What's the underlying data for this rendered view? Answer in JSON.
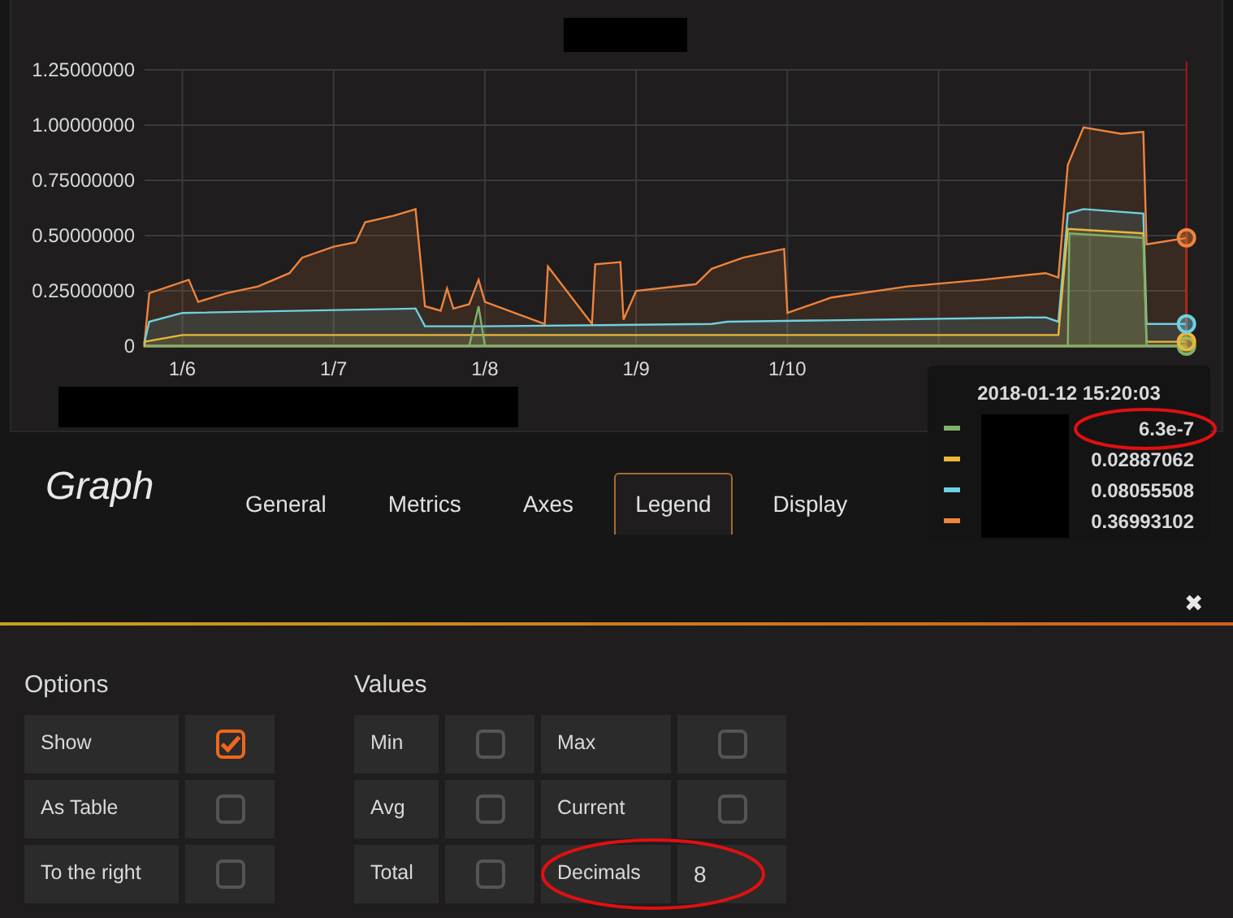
{
  "panel": {
    "chart_data": {
      "type": "area",
      "xlim": [
        "2018-01-05T18:00",
        "2018-01-12T15:30"
      ],
      "ylim": [
        0,
        1.25
      ],
      "xticks": [
        {
          "value": "2018-01-06",
          "label": "1/6"
        },
        {
          "value": "2018-01-07",
          "label": "1/7"
        },
        {
          "value": "2018-01-08",
          "label": "1/8"
        },
        {
          "value": "2018-01-09",
          "label": "1/9"
        },
        {
          "value": "2018-01-10",
          "label": "1/10"
        }
      ],
      "yticks": [
        {
          "value": 0,
          "label": "0"
        },
        {
          "value": 0.25,
          "label": "0.25000000"
        },
        {
          "value": 0.5,
          "label": "0.50000000"
        },
        {
          "value": 0.75,
          "label": "0.75000000"
        },
        {
          "value": 1,
          "label": "1.00000000"
        },
        {
          "value": 1.25,
          "label": "1.25000000"
        }
      ],
      "series": [
        {
          "color": "#ef843c",
          "x": [
            "2018-01-05T18:00",
            "2018-01-05T18:45",
            "2018-01-06T01:00",
            "2018-01-06T02:30",
            "2018-01-06T07:00",
            "2018-01-06T12:00",
            "2018-01-06T17:00",
            "2018-01-06T19:00",
            "2018-01-07T00:00",
            "2018-01-07T03:30",
            "2018-01-07T05:00",
            "2018-01-07T09:30",
            "2018-01-07T13:00",
            "2018-01-07T14:30",
            "2018-01-07T17:00",
            "2018-01-07T18:00",
            "2018-01-07T19:00",
            "2018-01-07T21:30",
            "2018-01-07T23:00",
            "2018-01-08T00:00",
            "2018-01-08T09:30",
            "2018-01-08T10:00",
            "2018-01-08T17:00",
            "2018-01-08T17:30",
            "2018-01-08T21:30",
            "2018-01-08T22:00",
            "2018-01-09T00:00",
            "2018-01-09T09:30",
            "2018-01-09T12:00",
            "2018-01-09T17:00",
            "2018-01-09T23:30",
            "2018-01-10T00:00",
            "2018-01-10T07:00",
            "2018-01-10T19:00",
            "2018-01-11T07:00",
            "2018-01-11T17:00",
            "2018-01-11T19:00",
            "2018-01-11T20:30",
            "2018-01-11T23:00",
            "2018-01-12T05:00",
            "2018-01-12T08:30",
            "2018-01-12T09:00",
            "2018-01-12T15:20"
          ],
          "values": [
            0.02,
            0.24,
            0.3,
            0.2,
            0.24,
            0.27,
            0.33,
            0.4,
            0.45,
            0.47,
            0.56,
            0.59,
            0.62,
            0.18,
            0.16,
            0.26,
            0.17,
            0.19,
            0.3,
            0.2,
            0.1,
            0.36,
            0.1,
            0.37,
            0.38,
            0.12,
            0.25,
            0.28,
            0.35,
            0.4,
            0.44,
            0.15,
            0.22,
            0.27,
            0.3,
            0.33,
            0.31,
            0.82,
            0.99,
            0.96,
            0.97,
            0.46,
            0.49
          ]
        },
        {
          "color": "#6ed0e0",
          "x": [
            "2018-01-05T18:00",
            "2018-01-05T18:45",
            "2018-01-06T00:00",
            "2018-01-07T13:00",
            "2018-01-07T14:30",
            "2018-01-08T00:00",
            "2018-01-09T12:00",
            "2018-01-09T14:30",
            "2018-01-11T17:00",
            "2018-01-11T19:00",
            "2018-01-11T20:30",
            "2018-01-11T23:00",
            "2018-01-12T08:30",
            "2018-01-12T09:00",
            "2018-01-12T15:20"
          ],
          "values": [
            0.02,
            0.11,
            0.15,
            0.17,
            0.09,
            0.09,
            0.1,
            0.11,
            0.13,
            0.11,
            0.6,
            0.62,
            0.6,
            0.1,
            0.1
          ]
        },
        {
          "color": "#eab839",
          "x": [
            "2018-01-05T18:00",
            "2018-01-06T00:00",
            "2018-01-11T19:00",
            "2018-01-11T20:30",
            "2018-01-12T08:30",
            "2018-01-12T09:00",
            "2018-01-12T15:20"
          ],
          "values": [
            0.02,
            0.05,
            0.05,
            0.53,
            0.51,
            0.02,
            0.02
          ]
        },
        {
          "color": "#7eb26d",
          "x": [
            "2018-01-05T18:00",
            "2018-01-07T21:30",
            "2018-01-07T23:00",
            "2018-01-08T00:00",
            "2018-01-11T20:30",
            "2018-01-11T20:45",
            "2018-01-12T08:30",
            "2018-01-12T09:00",
            "2018-01-12T15:20"
          ],
          "values": [
            0,
            0,
            0.18,
            0,
            0,
            0.51,
            0.49,
            0,
            0
          ]
        }
      ],
      "grid": true
    },
    "tooltip": {
      "time": "2018-01-12 15:20:03",
      "rows": [
        {
          "color": "#7eb26d",
          "value": "6.3e-7"
        },
        {
          "color": "#eab839",
          "value": "0.02887062"
        },
        {
          "color": "#6ed0e0",
          "value": "0.08055508"
        },
        {
          "color": "#ef843c",
          "value": "0.36993102"
        }
      ]
    }
  },
  "editor": {
    "title": "Graph",
    "tabs": [
      {
        "label": "General",
        "selected": false
      },
      {
        "label": "Metrics",
        "selected": false
      },
      {
        "label": "Axes",
        "selected": false
      },
      {
        "label": "Legend",
        "selected": true
      },
      {
        "label": "Display",
        "selected": false
      }
    ],
    "close": "✖"
  },
  "options": {
    "heading": "Options",
    "rows": [
      {
        "label": "Show",
        "checked": true
      },
      {
        "label": "As Table",
        "checked": false
      },
      {
        "label": "To the right",
        "checked": false
      }
    ]
  },
  "values": {
    "heading": "Values",
    "rows": [
      [
        {
          "label": "Min",
          "kind": "check",
          "checked": false
        },
        {
          "label": "Max",
          "kind": "check",
          "checked": false
        }
      ],
      [
        {
          "label": "Avg",
          "kind": "check",
          "checked": false
        },
        {
          "label": "Current",
          "kind": "check",
          "checked": false
        }
      ],
      [
        {
          "label": "Total",
          "kind": "check",
          "checked": false
        },
        {
          "label": "Decimals",
          "kind": "number",
          "value": "8"
        }
      ]
    ]
  }
}
